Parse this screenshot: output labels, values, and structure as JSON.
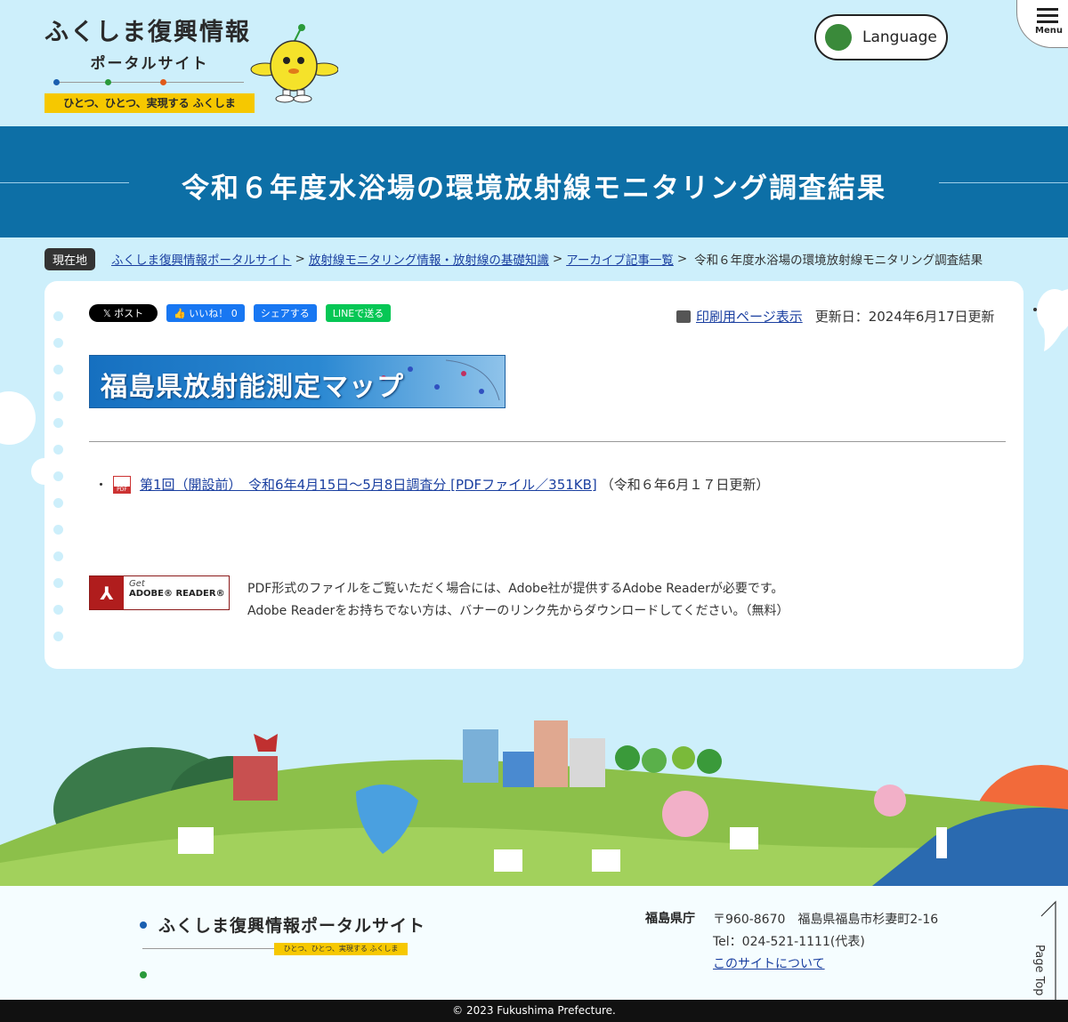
{
  "header": {
    "logo_title": "ふくしま復興情報",
    "logo_sub": "ポータルサイト",
    "logo_tag": "ひとつ、ひとつ、実現する ふくしま",
    "language_label": "Language",
    "menu_label": "Menu"
  },
  "page_title": "令和６年度水浴場の環境放射線モニタリング調査結果",
  "breadcrumb": {
    "badge": "現在地",
    "items": [
      "ふくしま復興情報ポータルサイト",
      "放射線モニタリング情報・放射線の基礎知識",
      "アーカイブ記事一覧"
    ],
    "separator": ">",
    "current": "令和６年度水浴場の環境放射線モニタリング調査結果"
  },
  "share": {
    "x_label": "𝕏 ポスト",
    "fb_like": "👍 いいね！ 0",
    "fb_share": "シェアする",
    "line_label": "LINEで送る"
  },
  "print": {
    "link": "印刷用ページ表示",
    "updated": "更新日：2024年6月17日更新"
  },
  "map_banner": "福島県放射能測定マップ",
  "pdf_item": {
    "bullet": "・",
    "icon_text": "PDF",
    "link": "第1回（開設前）　令和6年4月15日～5月8日調査分 [PDFファイル／351KB]",
    "note": "（令和６年6月１７日更新）"
  },
  "adobe": {
    "get": "Get",
    "name": "ADOBE® READER®",
    "note_line1": "PDF形式のファイルをご覧いただく場合には、Adobe社が提供するAdobe Readerが必要です。",
    "note_line2": "Adobe Readerをお持ちでない方は、バナーのリンク先からダウンロードしてください。（無料）"
  },
  "footer": {
    "logo_title": "ふくしま復興情報ポータルサイト",
    "logo_tag": "ひとつ、ひとつ、実現する ふくしま",
    "org": "福島県庁",
    "address": "〒960-8670　福島県福島市杉妻町2-16",
    "tel": "Tel：024-521-1111(代表)",
    "about_link": "このサイトについて",
    "page_top": "Page Top",
    "copyright": "© 2023 Fukushima Prefecture."
  },
  "colors": {
    "sky": "#cdeffb",
    "title_band": "#0d6fa6",
    "link": "#1a3fa0",
    "tag_yellow": "#f6c800"
  }
}
